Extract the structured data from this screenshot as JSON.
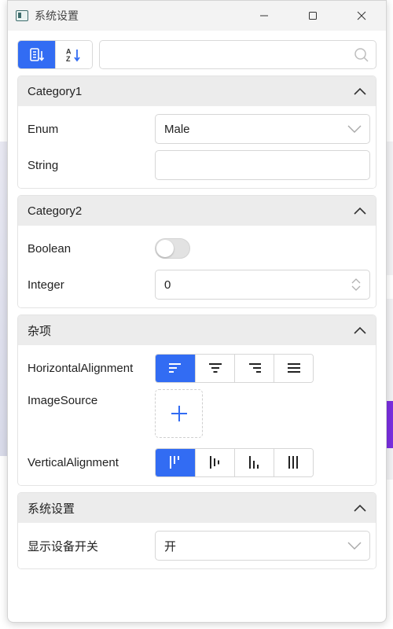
{
  "window": {
    "title": "系统设置",
    "controls": [
      "minimize",
      "maximize",
      "close"
    ]
  },
  "toolbar": {
    "sort_category_icon": "category-sort-icon",
    "sort_alpha_icon": "alpha-sort-icon",
    "search_placeholder": "",
    "search_icon": "search-icon"
  },
  "sections": [
    {
      "title": "Category1",
      "expanded": true,
      "rows": [
        {
          "label": "Enum",
          "type": "select",
          "value": "Male"
        },
        {
          "label": "String",
          "type": "text",
          "value": ""
        }
      ]
    },
    {
      "title": "Category2",
      "expanded": true,
      "rows": [
        {
          "label": "Boolean",
          "type": "toggle",
          "value": "off"
        },
        {
          "label": "Integer",
          "type": "number",
          "value": "0"
        }
      ]
    },
    {
      "title": "杂项",
      "expanded": true,
      "rows": [
        {
          "label": "HorizontalAlignment",
          "type": "button-group",
          "options": [
            "left",
            "center",
            "right",
            "stretch"
          ],
          "selected": "left"
        },
        {
          "label": "ImageSource",
          "type": "image-upload"
        },
        {
          "label": "VerticalAlignment",
          "type": "button-group",
          "options": [
            "top",
            "center",
            "bottom",
            "stretch"
          ],
          "selected": "top"
        }
      ]
    },
    {
      "title": "系统设置",
      "expanded": true,
      "rows": [
        {
          "label": "显示设备开关",
          "type": "select",
          "value": "开"
        }
      ]
    }
  ],
  "colors": {
    "accent": "#326cf3",
    "section_header_bg": "#ececec",
    "border": "#d6d6d6"
  }
}
